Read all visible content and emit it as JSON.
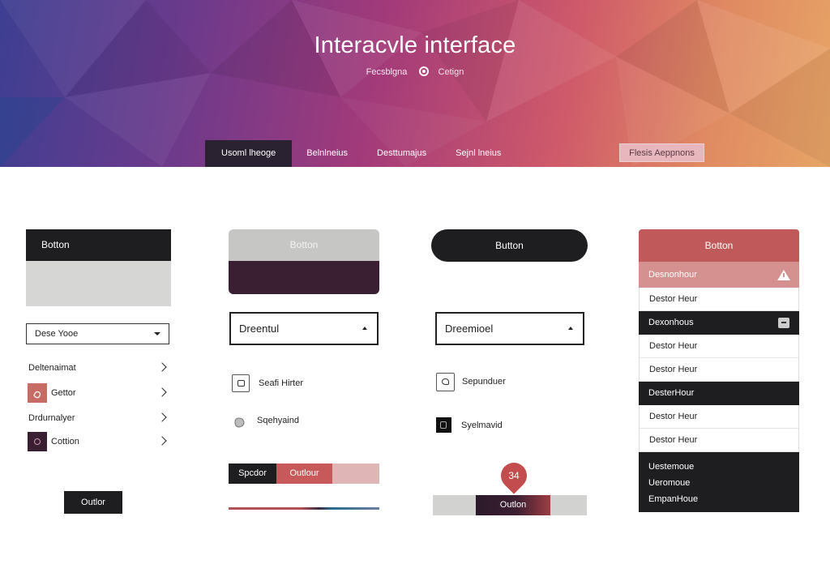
{
  "hero": {
    "title": "Interacvle interface",
    "sub_left": "Fecsblgna",
    "sub_right": "Cetign",
    "nav_tabs": [
      "Usoml lheoge",
      "Belnlneius",
      "Desttumajus",
      "Sejnl lneius"
    ],
    "cta_label": "Flesis Aeppnons"
  },
  "col1": {
    "button_label": "Botton",
    "select_value": "Dese Yooe",
    "list": [
      "Deltenaimat",
      "Gettor",
      "Drdurnalyer",
      "Cottion"
    ],
    "swatch_colors": [
      "#c86b64",
      "#3a1f33"
    ],
    "outline_button": "Outlor"
  },
  "col2": {
    "button_label": "Botton",
    "dropdown_value": "Dreentul",
    "checkbox_label": "Seafi Hirter",
    "toggle_label": "Sqehyaind",
    "segments": [
      "Spcdor",
      "Outlour"
    ]
  },
  "col3": {
    "pill_label": "Button",
    "dropdown_value": "Dreemioel",
    "checkbox_label": "Sepunduer",
    "radio_label": "Syelmavid",
    "slider_label": "Outlon",
    "slider_value": "34"
  },
  "col4": {
    "header": "Botton",
    "rows": [
      {
        "label": "Desnonhour",
        "style": "rose"
      },
      {
        "label": "Destor Heur",
        "style": "light"
      },
      {
        "label": "Dexonhous",
        "style": "dark"
      },
      {
        "label": "Destor Heur",
        "style": "light"
      },
      {
        "label": "Destor Heur",
        "style": "light"
      },
      {
        "label": "DesterHour",
        "style": "dark"
      },
      {
        "label": "Destor Heur",
        "style": "light"
      },
      {
        "label": "Destor Heur",
        "style": "light"
      }
    ],
    "footer": [
      "Uestemoue",
      "Ueromoue",
      "EmpanHoue"
    ]
  }
}
